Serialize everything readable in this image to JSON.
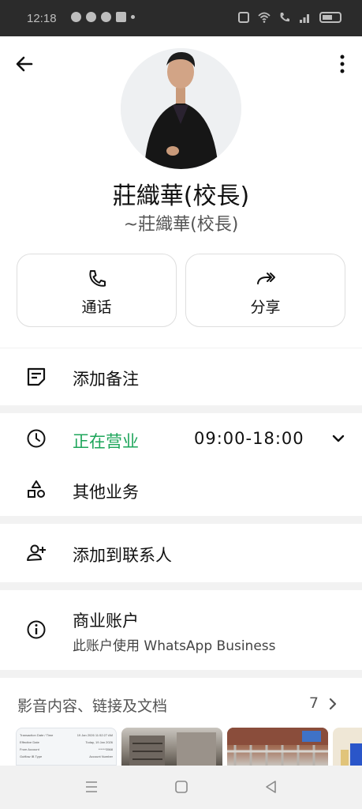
{
  "status": {
    "time": "12:18"
  },
  "profile": {
    "name": "莊織華(校長)",
    "push_name": "~莊織華(校長)"
  },
  "actions": {
    "call": "通话",
    "share": "分享"
  },
  "note": {
    "label": "添加备注"
  },
  "hours": {
    "status": "正在营业",
    "time": "09:00-18:00",
    "other": "其他业务"
  },
  "contact": {
    "add": "添加到联系人"
  },
  "business": {
    "title": "商业账户",
    "subtitle": "此账户使用 WhatsApp Business"
  },
  "media": {
    "header": "影音内容、链接及文档",
    "count": "7",
    "doc_lines": [
      "Transaction Date / Time",
      "Effective Date",
      "From Account",
      "Gutflow IB Type"
    ],
    "doc_values": [
      "19 Jan 2026 11:52:27 AM",
      "Today, 19 Jan 2026",
      "******3568",
      "Account Number"
    ]
  },
  "colors": {
    "open_green": "#1da55a"
  }
}
